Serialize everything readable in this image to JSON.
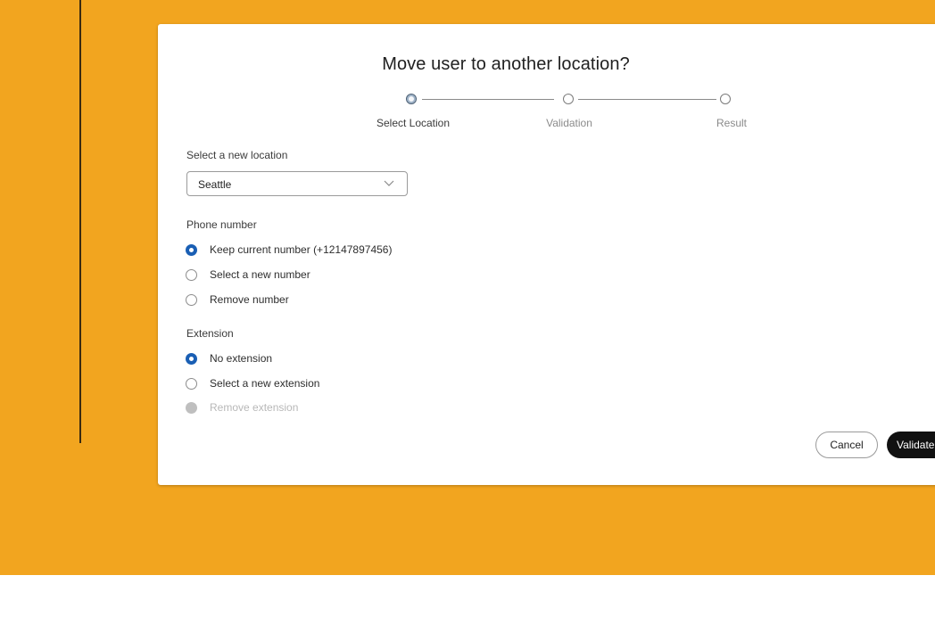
{
  "dialog": {
    "title": "Move user to another location?",
    "steps": [
      {
        "label": "Select Location",
        "active": true
      },
      {
        "label": "Validation",
        "active": false
      },
      {
        "label": "Result",
        "active": false
      }
    ],
    "location": {
      "label": "Select a new location",
      "selected": "Seattle"
    },
    "phone": {
      "label": "Phone number",
      "options": [
        {
          "label": "Keep current number (+12147897456)",
          "checked": true
        },
        {
          "label": "Select a new number",
          "checked": false
        },
        {
          "label": "Remove number",
          "checked": false
        }
      ]
    },
    "extension": {
      "label": "Extension",
      "options": [
        {
          "label": "No extension",
          "checked": true
        },
        {
          "label": "Select a new extension",
          "checked": false
        },
        {
          "label": "Remove extension",
          "checked": false,
          "disabled": true
        }
      ]
    },
    "buttons": {
      "cancel": "Cancel",
      "validate": "Validate"
    }
  },
  "colors": {
    "backdrop": "#f2a51f",
    "radio_checked": "#1a5fb4",
    "primary_button": "#111111"
  },
  "icons": {
    "dropdown": "chevron-down-icon"
  }
}
